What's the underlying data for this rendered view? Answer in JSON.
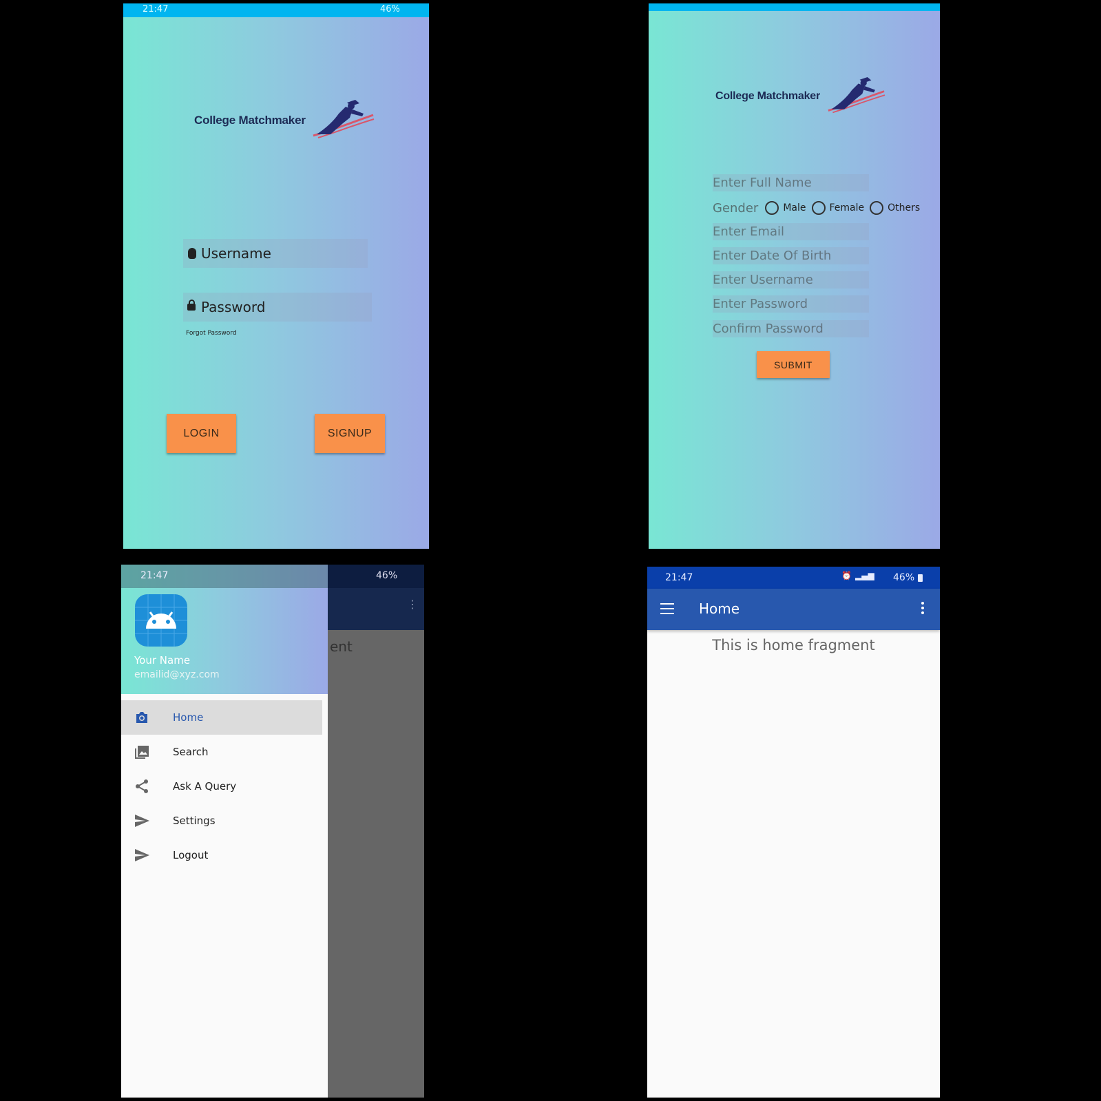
{
  "login": {
    "status_time": "21:47",
    "status_battery": "46%",
    "logo_text": "College Matchmaker",
    "username_placeholder": "Username",
    "password_placeholder": "Password",
    "forgot_password": "Forgot Password",
    "login_button": "LOGIN",
    "signup_button": "SIGNUP"
  },
  "register": {
    "logo_text": "College Matchmaker",
    "full_name_placeholder": "Enter Full Name",
    "gender_label": "Gender",
    "gender_options": [
      "Male",
      "Female",
      "Others"
    ],
    "email_placeholder": "Enter Email",
    "dob_placeholder": "Enter Date Of Birth",
    "username_placeholder": "Enter Username",
    "password_placeholder": "Enter Password",
    "confirm_password_placeholder": "Confirm Password",
    "submit_button": "SUBMIT"
  },
  "drawer": {
    "status_time": "21:47",
    "status_battery": "46%",
    "user_name": "Your Name",
    "user_email": "emailid@xyz.com",
    "background_text": "ent",
    "items": [
      {
        "label": "Home",
        "icon": "camera-icon",
        "selected": true
      },
      {
        "label": "Search",
        "icon": "gallery-icon",
        "selected": false
      },
      {
        "label": "Ask A Query",
        "icon": "share-icon",
        "selected": false
      },
      {
        "label": "Settings",
        "icon": "send-icon",
        "selected": false
      },
      {
        "label": "Logout",
        "icon": "send-icon",
        "selected": false
      }
    ]
  },
  "home": {
    "status_time": "21:47",
    "status_battery": "46%",
    "toolbar_title": "Home",
    "content_text": "This is home fragment"
  },
  "colors": {
    "accent_button": "#f9914a",
    "toolbar": "#2858ae",
    "statusbar_dark": "#0a3faa",
    "selected_item_text": "#2858ae"
  }
}
